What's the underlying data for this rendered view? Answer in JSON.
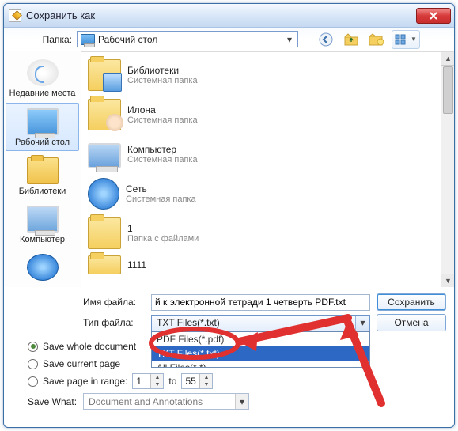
{
  "window": {
    "title": "Сохранить как"
  },
  "toolbar": {
    "folder_label": "Папка:",
    "folder_value": "Рабочий стол",
    "icons": {
      "back": "back-icon",
      "up": "up-level-icon",
      "new": "new-folder-icon",
      "views": "views-icon"
    }
  },
  "places": [
    {
      "id": "recent",
      "label": "Недавние места"
    },
    {
      "id": "desktop",
      "label": "Рабочий стол",
      "selected": true
    },
    {
      "id": "libs",
      "label": "Библиотеки"
    },
    {
      "id": "computer",
      "label": "Компьютер"
    },
    {
      "id": "network",
      "label": ""
    }
  ],
  "filelist": [
    {
      "name": "Библиотеки",
      "sub": "Системная папка",
      "kind": "lib"
    },
    {
      "name": "Илона",
      "sub": "Системная папка",
      "kind": "user"
    },
    {
      "name": "Компьютер",
      "sub": "Системная папка",
      "kind": "comp"
    },
    {
      "name": "Сеть",
      "sub": "Системная папка",
      "kind": "net"
    },
    {
      "name": "1",
      "sub": "Папка с файлами",
      "kind": "folder"
    },
    {
      "name": "1111",
      "sub": "",
      "kind": "folder"
    }
  ],
  "form": {
    "filename_label": "Имя файла:",
    "filename_value": "й к электронной тетради 1 четверть PDF.txt",
    "filetype_label": "Тип файла:",
    "filetype_value": "TXT Files(*.txt)",
    "filetype_options": [
      {
        "label": "PDF Files(*.pdf)",
        "cut": true
      },
      {
        "label": "TXT Files(*.txt)",
        "selected": true
      },
      {
        "label": "All Files(*.*)",
        "cut": true
      }
    ],
    "save_btn": "Сохранить",
    "cancel_btn": "Отмена"
  },
  "radios": {
    "whole": "Save whole document",
    "current": "Save current page",
    "range": "Save page in range:",
    "range_from": "1",
    "range_to_word": "to",
    "range_to": "55"
  },
  "savewhat": {
    "label": "Save What:",
    "value": "Document and Annotations"
  }
}
